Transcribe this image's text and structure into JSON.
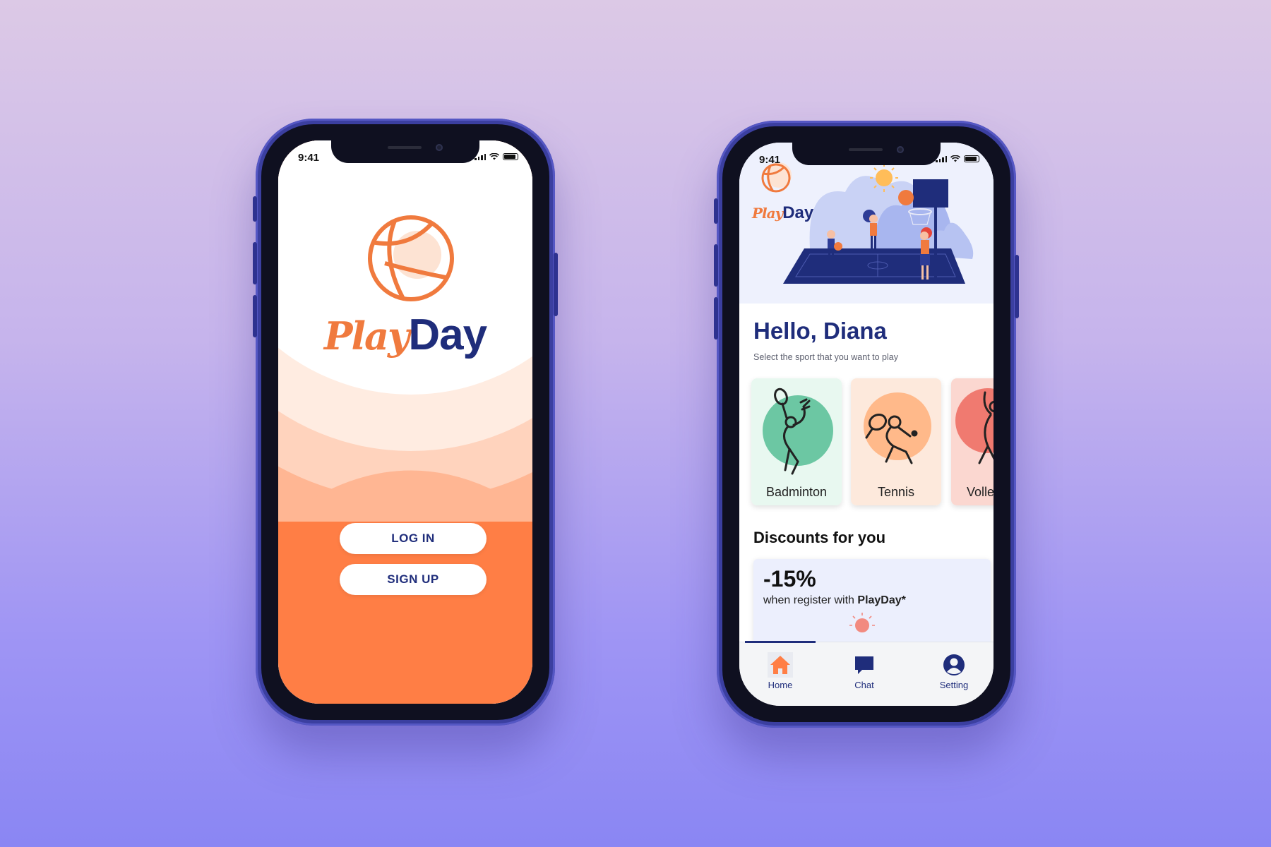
{
  "status_bar": {
    "time": "9:41"
  },
  "welcome_screen": {
    "brand_play": "Play",
    "brand_day": "Day",
    "login_label": "LOG IN",
    "signup_label": "SIGN UP"
  },
  "home_screen": {
    "brand_play": "Play",
    "brand_day": "Day",
    "greeting": "Hello, Diana",
    "subtitle": "Select the sport that you want to play",
    "sports": [
      {
        "label": "Badminton",
        "bg": "#e8f8f0",
        "circle": "#6cc7a3"
      },
      {
        "label": "Tennis",
        "bg": "#fde9dc",
        "circle": "#ffb98a"
      },
      {
        "label": "Volle",
        "bg": "#fbd7d0",
        "circle": "#f07a70"
      }
    ],
    "discounts_title": "Discounts for you",
    "discount": {
      "percent": "-15%",
      "text_prefix": "when register with ",
      "text_brand": "PlayDay*"
    },
    "tabs": [
      {
        "label": "Home",
        "icon": "home-icon"
      },
      {
        "label": "Chat",
        "icon": "chat-icon"
      },
      {
        "label": "Setting",
        "icon": "user-icon"
      }
    ]
  },
  "colors": {
    "brand_orange": "#ff7e45",
    "brand_navy": "#1f2d7b",
    "background_top": "#dcc9e6",
    "background_bottom": "#8a86f3"
  }
}
